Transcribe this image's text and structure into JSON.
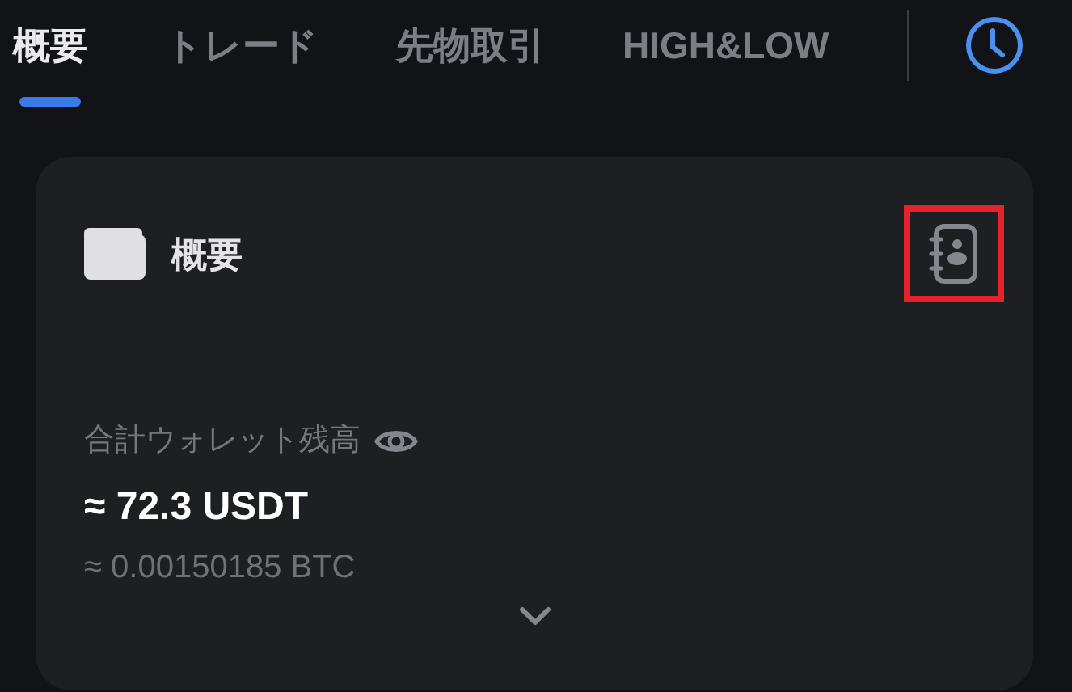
{
  "tabs": [
    {
      "label": "概要",
      "selected": true
    },
    {
      "label": "トレード",
      "selected": false
    },
    {
      "label": "先物取引",
      "selected": false
    },
    {
      "label": "HIGH&LOW",
      "selected": false
    }
  ],
  "card": {
    "title": "概要",
    "address_book_highlighted": true,
    "balance_label": "合計ウォレット残高",
    "balance": "≈ 72.3 USDT",
    "balance_btc": "≈ 0.00150185 BTC"
  }
}
